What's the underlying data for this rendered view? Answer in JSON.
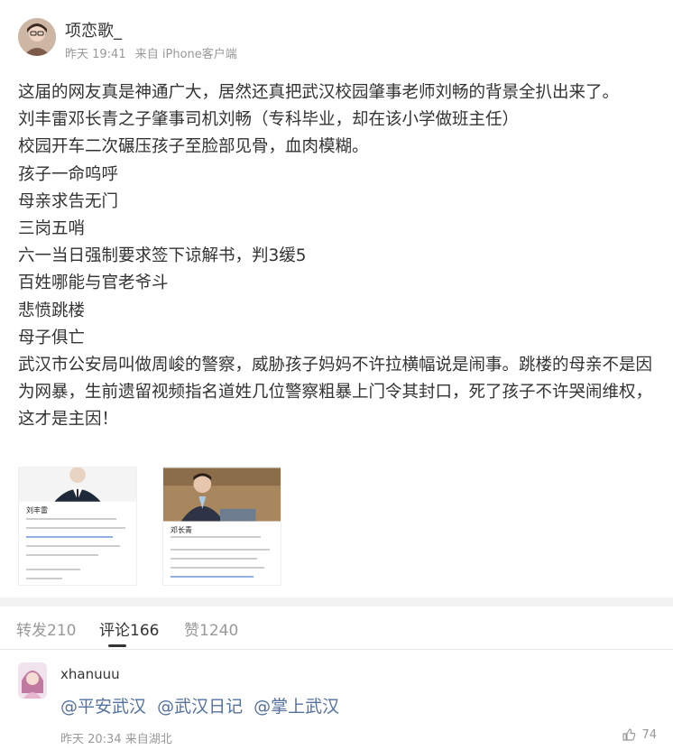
{
  "post": {
    "author": "项恋歌_",
    "meta": {
      "time": "昨天 19:41",
      "source": "来自 iPhone客户端"
    },
    "content": [
      "这届的网友真是神通广大，居然还真把武汉校园肇事老师刘畅的背景全扒出来了。",
      "刘丰雷邓长青之子肇事司机刘畅（专科毕业，却在该小学做班主任）",
      "校园开车二次碾压孩子至脸部见骨，血肉模糊。",
      "孩子一命呜呼",
      "母亲求告无门",
      "三岗五哨",
      "六一当日强制要求签下谅解书，判3缓5",
      "百姓哪能与官老爷斗",
      "悲愤跳楼",
      "母子俱亡",
      "武汉市公安局叫做周峻的警察，威胁孩子妈妈不许拉横幅说是闹事。跳楼的母亲不是因为网暴，生前遗留视频指名道姓几位警察粗暴上门令其封口，死了孩子不许哭闹维权，这才是主因！"
    ],
    "images": [
      {
        "title": "刘丰雷"
      },
      {
        "title": "邓长青"
      }
    ]
  },
  "tabs": [
    {
      "label": "转发210"
    },
    {
      "label": "评论166"
    },
    {
      "label": "赞1240"
    }
  ],
  "comment": {
    "author": "xhanuuu",
    "mentions": [
      "@平安武汉",
      "@武汉日记",
      "@掌上武汉"
    ],
    "meta": "昨天 20:34 来自湖北",
    "likes": "74"
  }
}
